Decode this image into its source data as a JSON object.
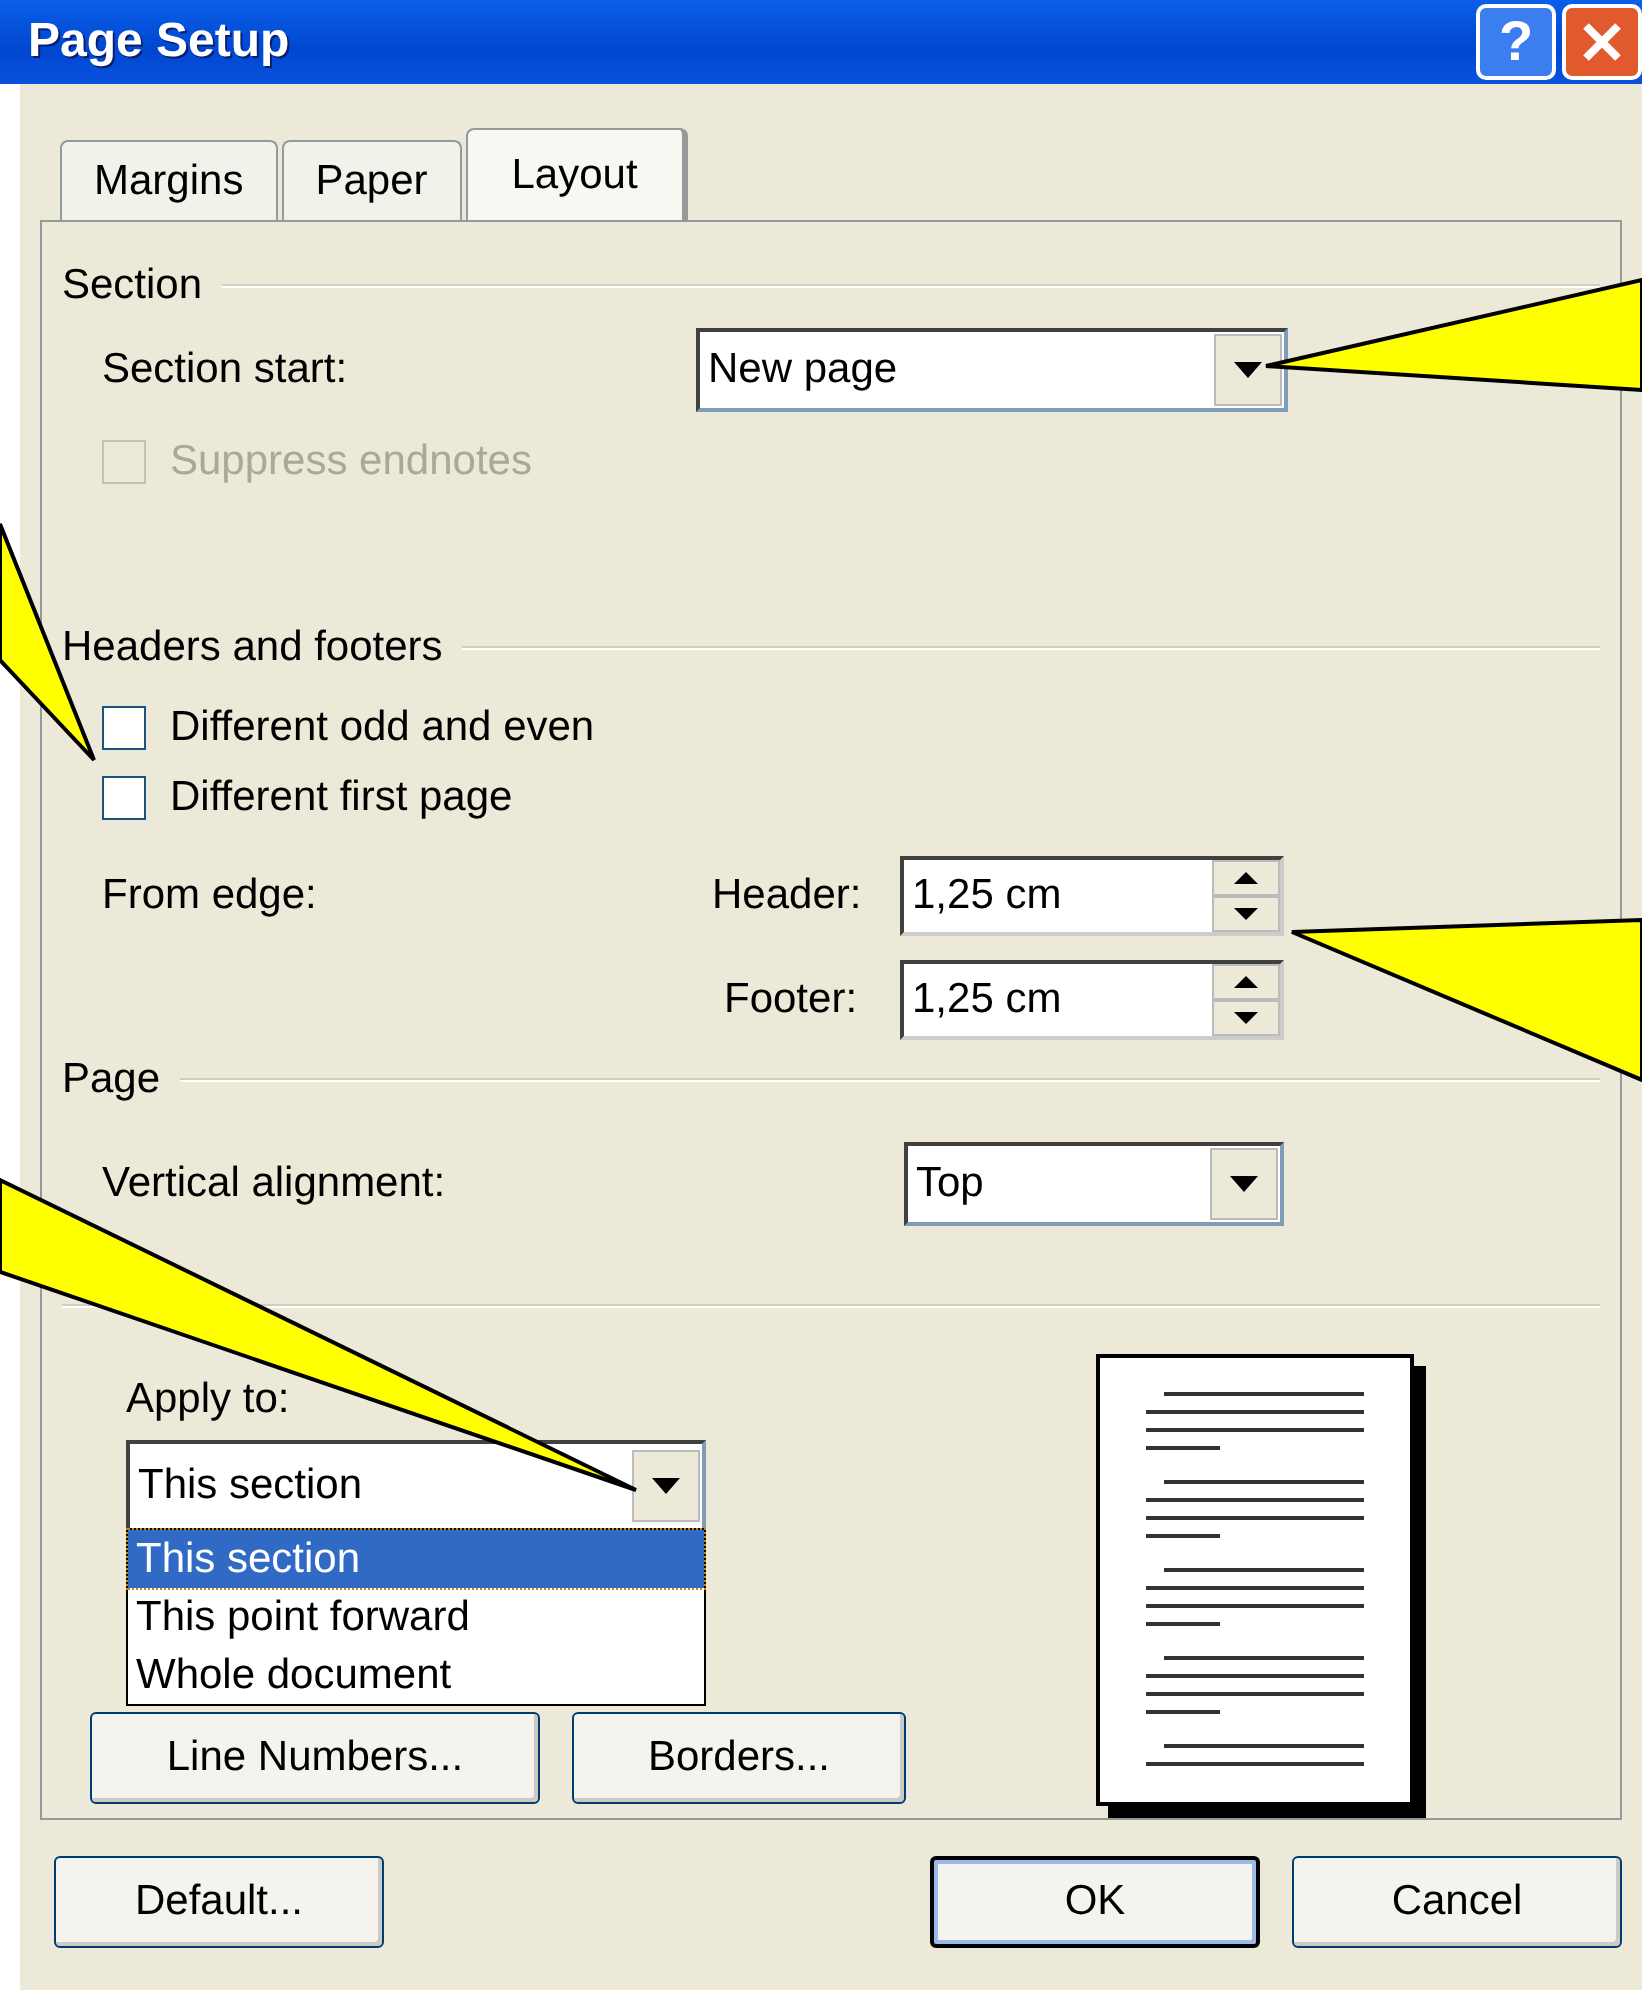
{
  "window": {
    "title": "Page Setup",
    "help_button": "?"
  },
  "tabs": [
    {
      "label": "Margins",
      "selected": false
    },
    {
      "label": "Paper",
      "selected": false
    },
    {
      "label": "Layout",
      "selected": true
    }
  ],
  "section": {
    "heading": "Section",
    "section_start": {
      "label": "Section start:",
      "value": "New page"
    },
    "suppress_endnotes": {
      "label": "Suppress endnotes",
      "checked": false,
      "disabled": true
    }
  },
  "headers_footers": {
    "heading": "Headers and footers",
    "options": [
      {
        "label": "Different odd and even",
        "checked": false
      },
      {
        "label": "Different first page",
        "checked": false
      }
    ],
    "from_edge_label": "From edge:",
    "header": {
      "label": "Header:",
      "value": "1,25 cm"
    },
    "footer": {
      "label": "Footer:",
      "value": "1,25 cm"
    }
  },
  "page": {
    "heading": "Page",
    "vertical_alignment": {
      "label": "Vertical alignment:",
      "value": "Top"
    }
  },
  "preview": {
    "apply_to": {
      "label": "Apply to:",
      "value": "This section",
      "expanded": true,
      "options": [
        {
          "label": "This section",
          "selected": true
        },
        {
          "label": "This point forward",
          "selected": false
        },
        {
          "label": "Whole document",
          "selected": false
        }
      ]
    }
  },
  "layout_buttons": [
    "Line Numbers...",
    "Borders..."
  ],
  "dialog_buttons": [
    {
      "label": "Default...",
      "default": false
    },
    {
      "label": "OK",
      "default": true
    },
    {
      "label": "Cancel",
      "default": false
    }
  ]
}
